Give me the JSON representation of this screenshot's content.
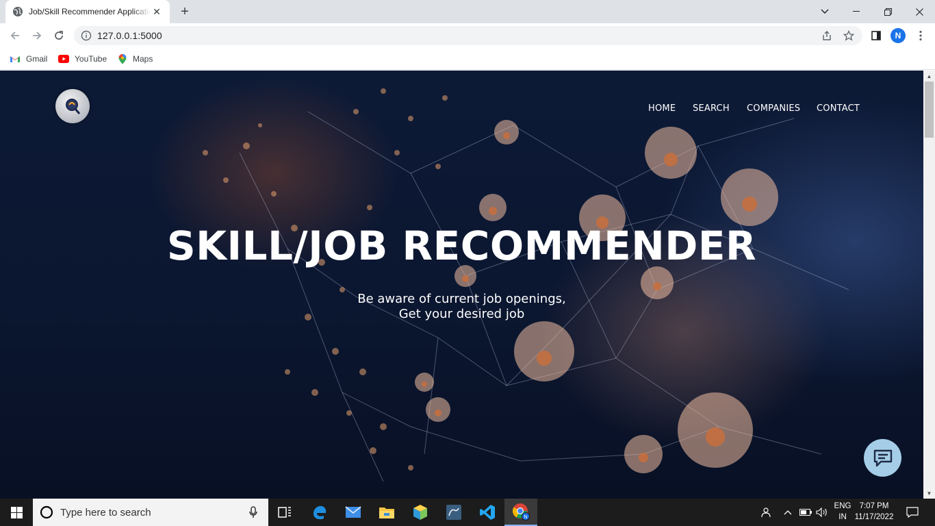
{
  "browser": {
    "tab_title": "Job/Skill Recommender Application",
    "url": "127.0.0.1:5000",
    "profile_initial": "N",
    "bookmarks": [
      {
        "label": "Gmail",
        "icon": "gmail-icon"
      },
      {
        "label": "YouTube",
        "icon": "youtube-icon"
      },
      {
        "label": "Maps",
        "icon": "maps-icon"
      }
    ]
  },
  "site": {
    "nav": [
      {
        "label": "HOME"
      },
      {
        "label": "SEARCH"
      },
      {
        "label": "COMPANIES"
      },
      {
        "label": "CONTACT"
      }
    ],
    "hero": {
      "title": "SKILL/JOB RECOMMENDER",
      "subtitle_line1": "Be aware of current job openings,",
      "subtitle_line2": "Get your desired job"
    }
  },
  "taskbar": {
    "search_placeholder": "Type here to search",
    "lang_line1": "ENG",
    "lang_line2": "IN",
    "time": "7:07 PM",
    "date": "11/17/2022"
  },
  "colors": {
    "page_bg": "#0b1630",
    "accent_chat": "#a5cde8",
    "profile": "#1a73e8"
  }
}
